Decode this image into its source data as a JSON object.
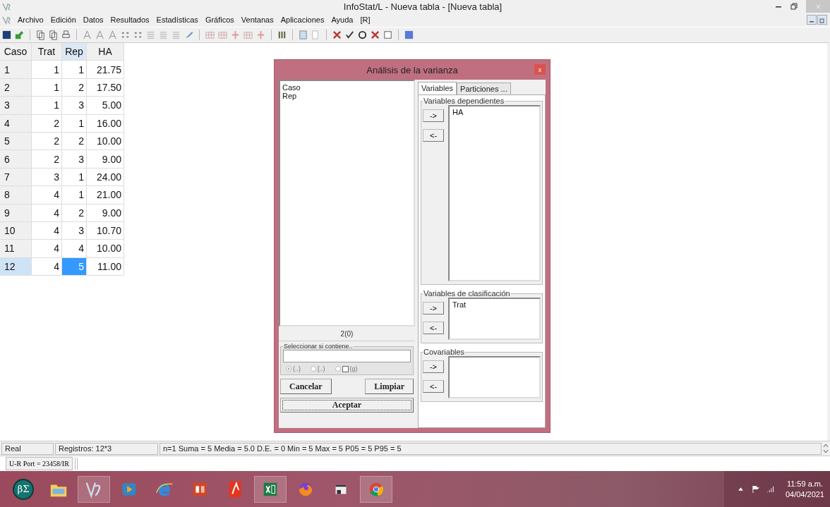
{
  "window": {
    "title": "InfoStat/L - Nueva tabla - [Nueva tabla]"
  },
  "menu": [
    "Archivo",
    "Edición",
    "Datos",
    "Resultados",
    "Estadísticas",
    "Gráficos",
    "Ventanas",
    "Aplicaciones",
    "Ayuda",
    "[R]"
  ],
  "table": {
    "columns": [
      {
        "label": "Caso",
        "selected": false
      },
      {
        "label": "Trat",
        "selected": false
      },
      {
        "label": "Rep",
        "selected": true
      },
      {
        "label": "HA",
        "selected": false
      }
    ],
    "rows": [
      {
        "cells": [
          "1",
          "1",
          "1",
          "21.75"
        ],
        "selected": false
      },
      {
        "cells": [
          "2",
          "1",
          "2",
          "17.50"
        ],
        "selected": false
      },
      {
        "cells": [
          "3",
          "1",
          "3",
          "5.00"
        ],
        "selected": false
      },
      {
        "cells": [
          "4",
          "2",
          "1",
          "16.00"
        ],
        "selected": false
      },
      {
        "cells": [
          "5",
          "2",
          "2",
          "10.00"
        ],
        "selected": false
      },
      {
        "cells": [
          "6",
          "2",
          "3",
          "9.00"
        ],
        "selected": false
      },
      {
        "cells": [
          "7",
          "3",
          "1",
          "24.00"
        ],
        "selected": false
      },
      {
        "cells": [
          "8",
          "4",
          "1",
          "21.00"
        ],
        "selected": false
      },
      {
        "cells": [
          "9",
          "4",
          "2",
          "9.00"
        ],
        "selected": false
      },
      {
        "cells": [
          "10",
          "4",
          "3",
          "10.70"
        ],
        "selected": false
      },
      {
        "cells": [
          "11",
          "4",
          "4",
          "10.00"
        ],
        "selected": false
      },
      {
        "cells": [
          "12",
          "4",
          "5",
          "11.00"
        ],
        "selected": true
      }
    ]
  },
  "dialog": {
    "title": "Análisis de la varianza",
    "close": "x",
    "variables": [
      "Caso",
      "Rep"
    ],
    "count": "2(0)",
    "filter": {
      "label": "Seleccionar si contiene..",
      "disabled": true,
      "options": [
        {
          "label": "(..)",
          "selected": true,
          "checkbox": false
        },
        {
          "label": "[..)",
          "selected": false,
          "checkbox": false
        },
        {
          "label": "(g)",
          "selected": false,
          "checkbox": true
        }
      ]
    },
    "buttons": [
      {
        "label": "Cancelar",
        "focused": false
      },
      {
        "label": "Limpiar",
        "focused": false
      },
      {
        "label": "Aceptar",
        "focused": true
      }
    ],
    "tabs": [
      {
        "label": "Variables",
        "selected": true
      },
      {
        "label": "Particiones ...",
        "selected": false
      }
    ],
    "groups": [
      {
        "title": "Variables dependientes",
        "items": [
          "HA"
        ],
        "add": "->",
        "remove": "<-"
      },
      {
        "title": "Variables de clasificación",
        "items": [
          "Trat"
        ],
        "add": "->",
        "remove": "<-"
      },
      {
        "title": "Covariables",
        "add": "->",
        "remove": "<-"
      }
    ]
  },
  "status_bar": [
    "Real",
    "Registros: 12*3",
    "n=1  Suma = 5  Media = 5.0  D.E. = 0  Min = 5  Max = 5  P05 = 5  P95 = 5"
  ],
  "port_bar": "U-R Port = 23458/IR",
  "taskbar": {
    "apps": [
      {
        "kind": "beta-sigma",
        "label": "βΣ",
        "running": false
      },
      {
        "kind": "folder",
        "running": false
      },
      {
        "kind": "infostat",
        "running": true
      },
      {
        "kind": "media",
        "running": false
      },
      {
        "kind": "browser-e",
        "running": false
      },
      {
        "kind": "slides",
        "running": false
      },
      {
        "kind": "pdf",
        "running": false
      },
      {
        "kind": "sheet",
        "running": true
      },
      {
        "kind": "fox",
        "running": false
      },
      {
        "kind": "window",
        "running": false
      },
      {
        "kind": "chrome",
        "running": true
      }
    ],
    "time": "11:59 a.m.",
    "date": "04/04/2021"
  }
}
